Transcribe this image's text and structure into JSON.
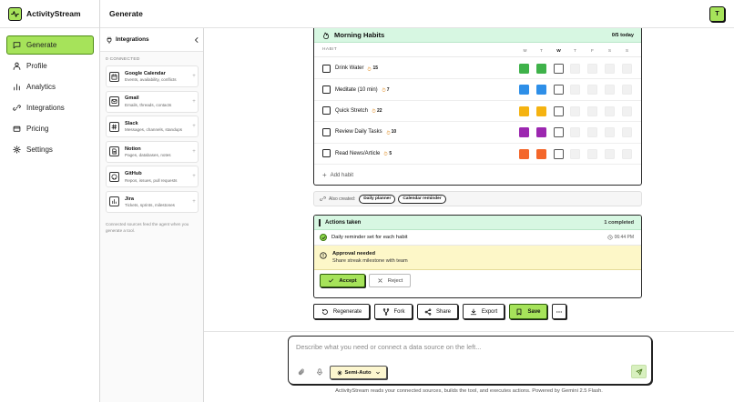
{
  "app": {
    "name": "ActivityStream",
    "page_title": "Generate",
    "avatar_initial": "T"
  },
  "sidebar": {
    "items": [
      {
        "label": "Generate",
        "icon": "chat-icon",
        "active": true
      },
      {
        "label": "Profile",
        "icon": "user-icon",
        "active": false
      },
      {
        "label": "Analytics",
        "icon": "chart-icon",
        "active": false
      },
      {
        "label": "Integrations",
        "icon": "link-icon",
        "active": false
      },
      {
        "label": "Pricing",
        "icon": "card-icon",
        "active": false
      },
      {
        "label": "Settings",
        "icon": "gear-icon",
        "active": false
      }
    ]
  },
  "integrations": {
    "title": "Integrations",
    "connected_count": "0 CONNECTED",
    "items": [
      {
        "name": "Google Calendar",
        "desc": "Events, availability, conflicts"
      },
      {
        "name": "Gmail",
        "desc": "Emails, threads, contacts"
      },
      {
        "name": "Slack",
        "desc": "Messages, channels, standups"
      },
      {
        "name": "Notion",
        "desc": "Pages, databases, notes"
      },
      {
        "name": "GitHub",
        "desc": "Repos, issues, pull requests"
      },
      {
        "name": "Jira",
        "desc": "Tickets, sprints, milestones"
      }
    ],
    "footnote": "Connected sources feed the agent when you generate a tool."
  },
  "habits": {
    "title": "Morning Habits",
    "today": "0/5 today",
    "column_label": "HABIT",
    "days": [
      "M",
      "T",
      "W",
      "T",
      "F",
      "S",
      "S"
    ],
    "today_index": 2,
    "rows": [
      {
        "name": "Drink Water",
        "streak": "15",
        "color": "#3fb24a",
        "done_days": 2
      },
      {
        "name": "Meditate (10 min)",
        "streak": "7",
        "color": "#2e8fe8",
        "done_days": 2
      },
      {
        "name": "Quick Stretch",
        "streak": "22",
        "color": "#f5b311",
        "done_days": 2
      },
      {
        "name": "Review Daily Tasks",
        "streak": "10",
        "color": "#9c27b0",
        "done_days": 2
      },
      {
        "name": "Read News/Article",
        "streak": "5",
        "color": "#f4662a",
        "done_days": 2
      }
    ],
    "add_label": "Add habit"
  },
  "also_created": {
    "label": "Also created:",
    "chips": [
      "Daily planner",
      "Calendar reminder"
    ]
  },
  "actions": {
    "title": "Actions taken",
    "completed": "1 completed",
    "item_text": "Daily reminder set for each habit",
    "item_time": "06:44 PM",
    "approval_title": "Approval needed",
    "approval_desc": "Share streak milestone with team",
    "accept_label": "Accept",
    "reject_label": "Reject"
  },
  "toolbar": {
    "regenerate": "Regenerate",
    "fork": "Fork",
    "share": "Share",
    "export": "Export",
    "save": "Save"
  },
  "composer": {
    "placeholder": "Describe what you need or connect a data source on the left...",
    "mode": "Semi-Auto"
  },
  "footer": "ActivityStream reads your connected sources, builds the tool, and executes actions. Powered by Gemini 2.5 Flash.",
  "colors": {
    "accent": "#a6e35a",
    "mint": "#d7f7e2",
    "approval": "#fdf7c8"
  }
}
